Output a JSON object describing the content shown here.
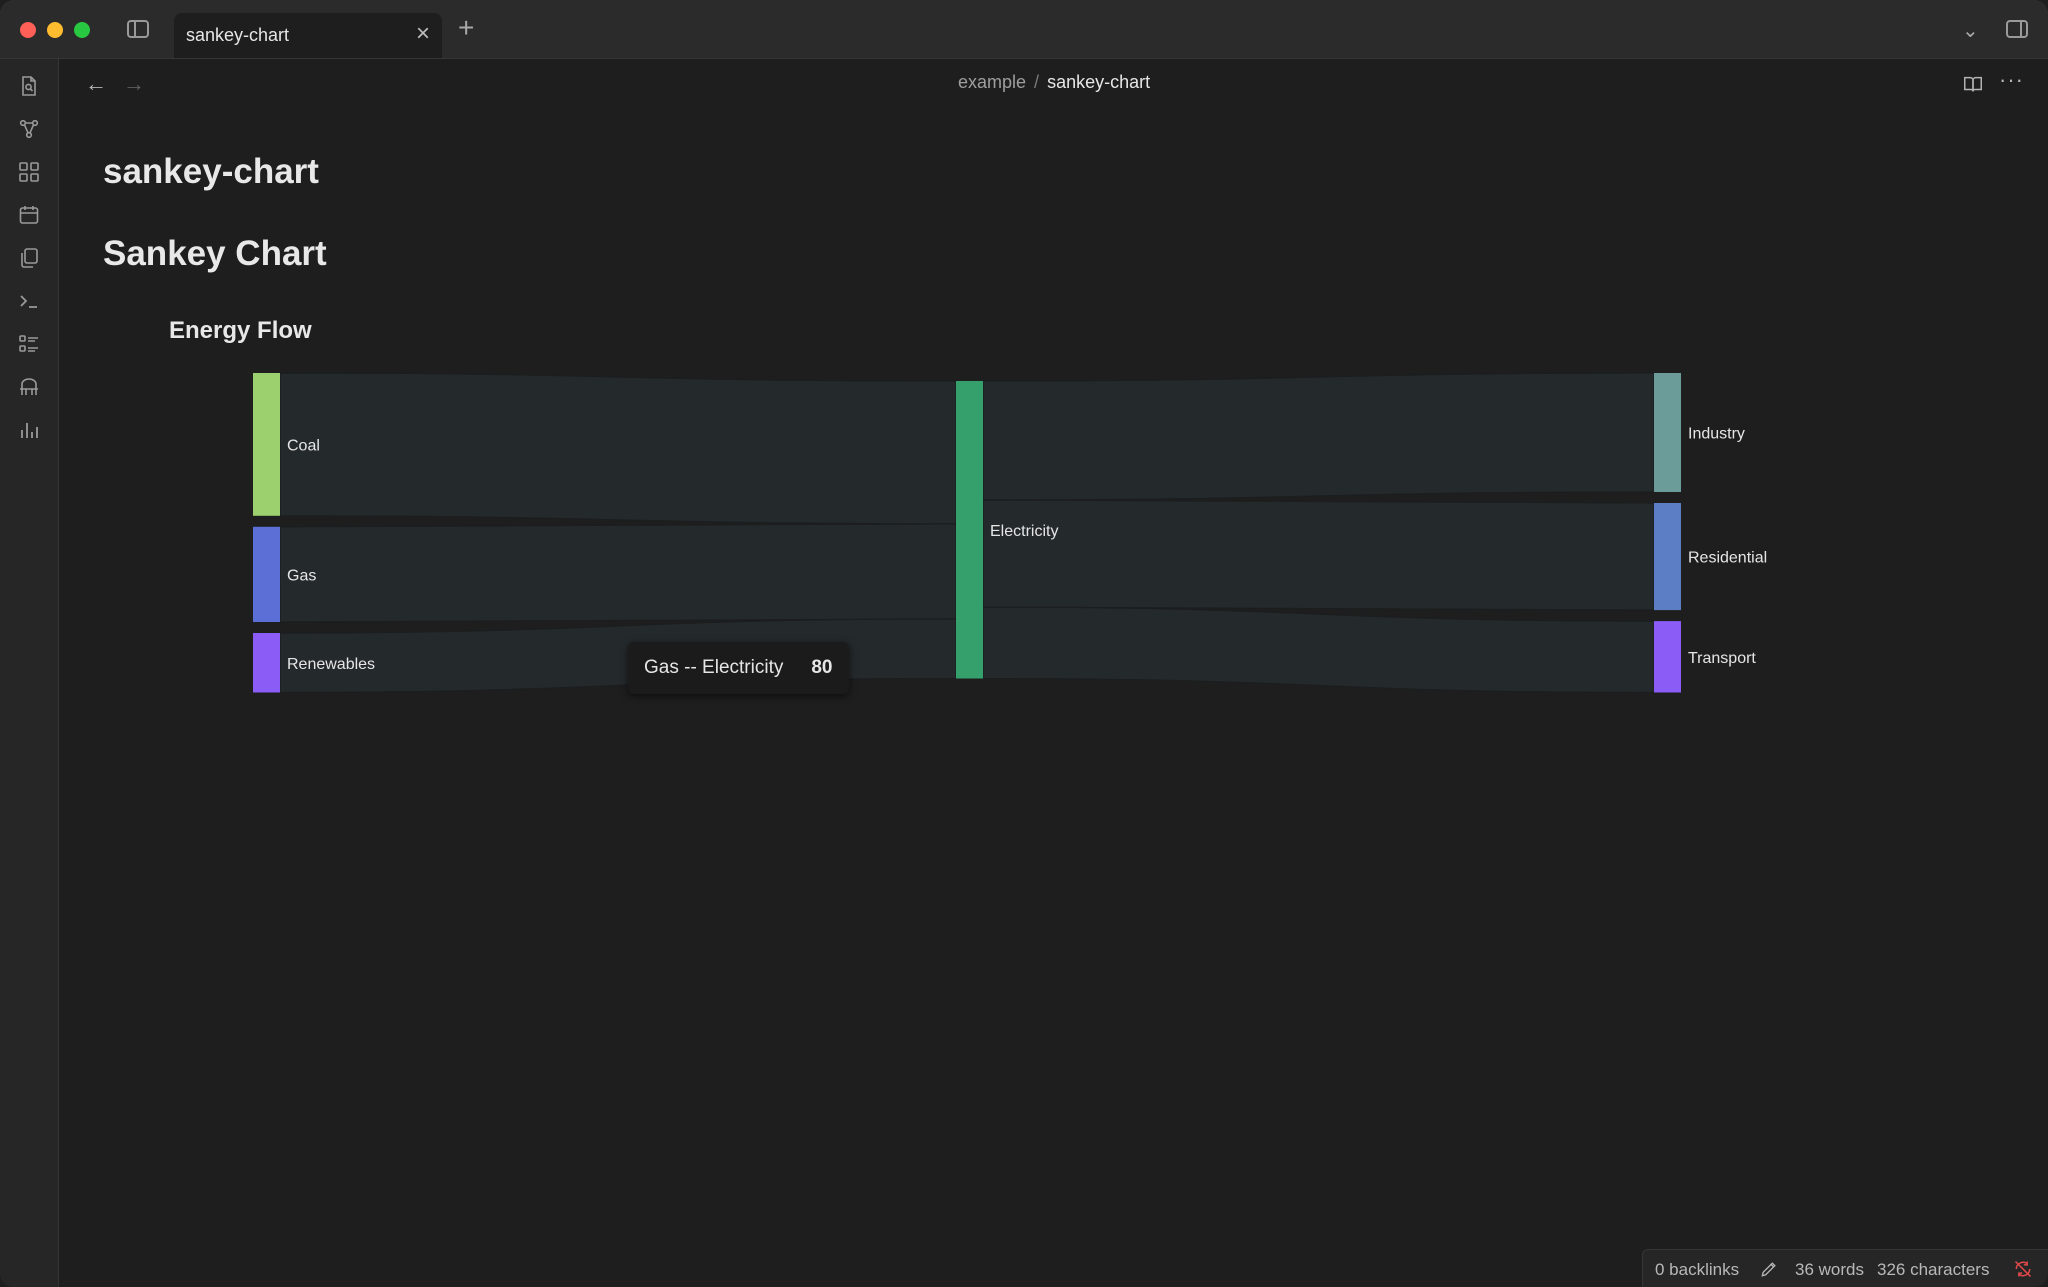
{
  "tab": {
    "title": "sankey-chart"
  },
  "breadcrumb": {
    "folder": "example",
    "separator": "/",
    "file": "sankey-chart"
  },
  "document": {
    "inline_title": "sankey-chart",
    "heading": "Sankey Chart"
  },
  "tooltip": {
    "label": "Gas -- Electricity",
    "value": "80"
  },
  "chart_data": {
    "type": "sankey",
    "title": "Energy Flow",
    "nodes": [
      {
        "name": "Coal",
        "color": "#9ccf6e",
        "column": 0
      },
      {
        "name": "Gas",
        "color": "#5b6fd6",
        "column": 0
      },
      {
        "name": "Renewables",
        "color": "#8b5cf6",
        "column": 0
      },
      {
        "name": "Electricity",
        "color": "#36a06c",
        "column": 1
      },
      {
        "name": "Industry",
        "color": "#6b9c99",
        "column": 2
      },
      {
        "name": "Residential",
        "color": "#5b7ec4",
        "column": 2
      },
      {
        "name": "Transport",
        "color": "#8b5cf6",
        "column": 2
      }
    ],
    "links": [
      {
        "source": "Coal",
        "target": "Electricity",
        "value": 120
      },
      {
        "source": "Gas",
        "target": "Electricity",
        "value": 80
      },
      {
        "source": "Renewables",
        "target": "Electricity",
        "value": 50
      },
      {
        "source": "Electricity",
        "target": "Industry",
        "value": 100
      },
      {
        "source": "Electricity",
        "target": "Residential",
        "value": 90
      },
      {
        "source": "Electricity",
        "target": "Transport",
        "value": 60
      }
    ]
  },
  "statusbar": {
    "backlinks": "0 backlinks",
    "words": "36 words",
    "characters": "326 characters"
  },
  "colors": {
    "link": "#24292b",
    "background": "#1e1e1e"
  },
  "icons": {
    "ribbon": [
      "search-file-icon",
      "graph-view-icon",
      "canvas-icon",
      "calendar-icon",
      "copy-icon",
      "terminal-icon",
      "kanban-icon",
      "bookmark-stand-icon",
      "chart-icon"
    ]
  }
}
